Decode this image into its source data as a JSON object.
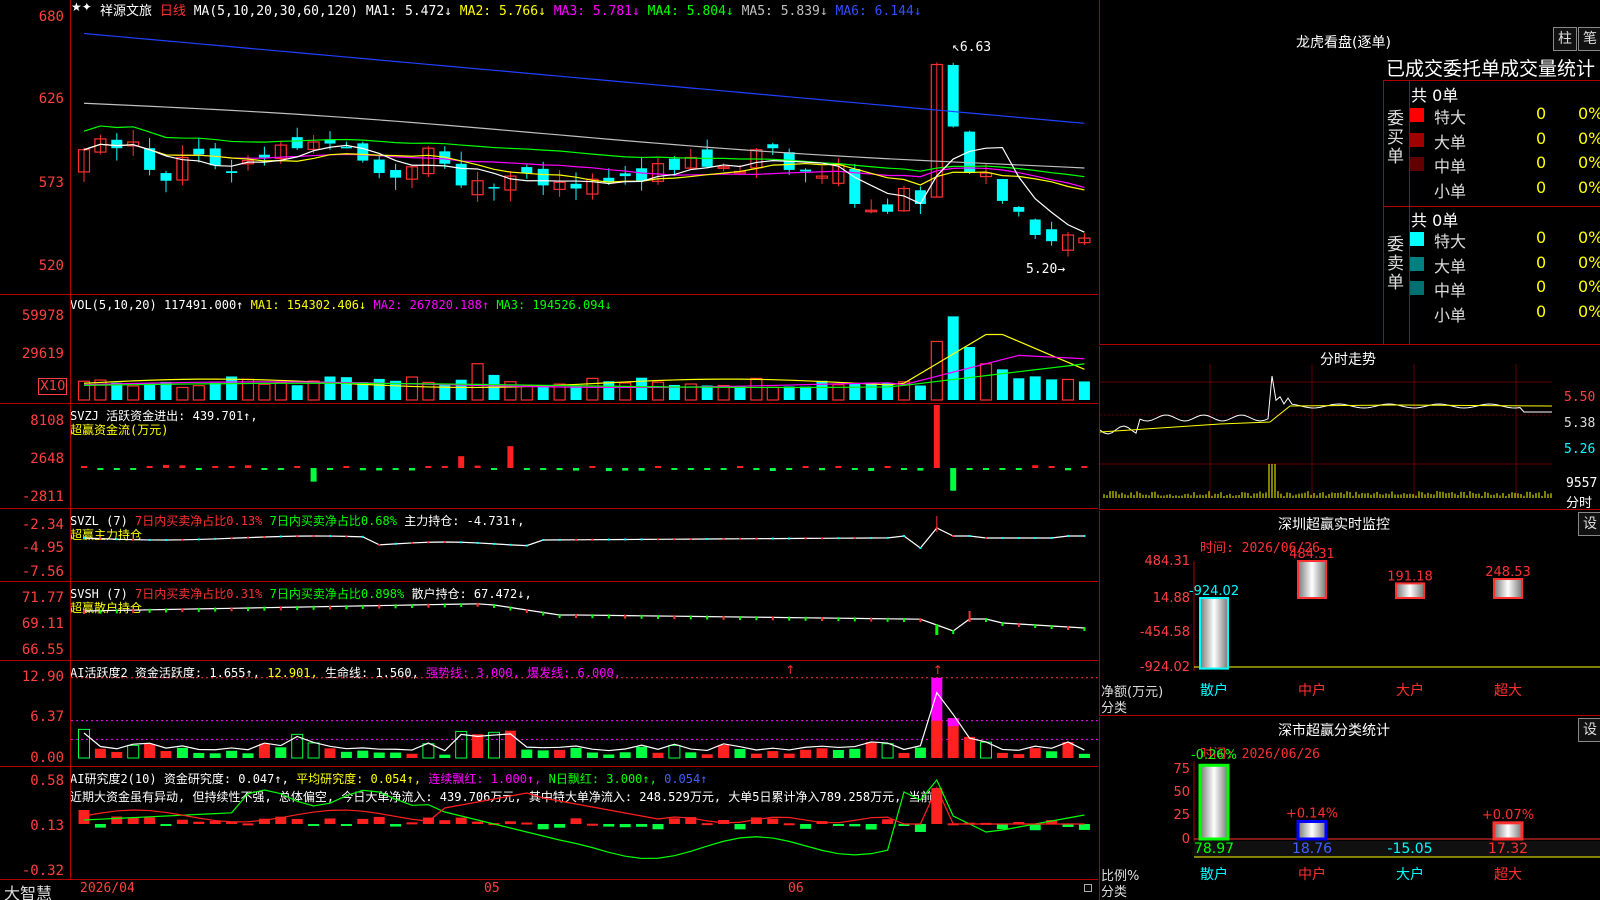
{
  "stock": {
    "name": "祥源文旅",
    "period": "日线"
  },
  "main": {
    "ma_label": "MA(5,10,20,30,60,120)",
    "ma": [
      {
        "n": "MA1:",
        "v": "5.472↓",
        "c": "#ffffff"
      },
      {
        "n": "MA2:",
        "v": "5.766↓",
        "c": "#ffff00"
      },
      {
        "n": "MA3:",
        "v": "5.781↓",
        "c": "#ff00ff"
      },
      {
        "n": "MA4:",
        "v": "5.804↓",
        "c": "#00ff00"
      },
      {
        "n": "MA5:",
        "v": "5.839↓",
        "c": "#c0c0c0"
      },
      {
        "n": "MA6:",
        "v": "6.144↓",
        "c": "#3050ff"
      }
    ],
    "y": [
      "680",
      "626",
      "573",
      "520"
    ],
    "hi": "6.63",
    "lo": "5.20"
  },
  "vol": {
    "label": "VOL(5,10,20)",
    "val": "117491.000↑",
    "ma1": "MA1: 154302.406↓",
    "ma2": "MA2: 267820.188↑",
    "ma3": "MA3: 194526.094↓",
    "y": [
      "59978",
      "29619",
      "X10"
    ]
  },
  "svzj": {
    "label": "SVZJ",
    "t1": "活跃资金进出: 439.701↑,",
    "t2": "超赢资金流(万元)",
    "y": [
      "8108",
      "2648",
      "-2811"
    ]
  },
  "svzl": {
    "label": "SVZL (7)",
    "a": "7日内买卖净占比0.13%",
    "b": "7日内买卖净占比0.68%",
    "c": "主力持仓: -4.731↑,",
    "t2": "超赢主力持仓",
    "y": [
      "-2.34",
      "-4.95",
      "-7.56"
    ]
  },
  "svsh": {
    "label": "SVSH (7)",
    "a": "7日内买卖净占比0.31%",
    "b": "7日内买卖净占比0.898%",
    "c": "散户持仓: 67.472↓,",
    "t2": "超赢散户持仓",
    "y": [
      "71.77",
      "69.11",
      "66.55"
    ]
  },
  "ai1": {
    "label": "AI活跃度2",
    "a": "资金活跃度: 1.655↑,",
    "b": "12.901,",
    "c": "生命线: 1.560,",
    "d": "强势线: 3.000,",
    "e": "爆发线: 6.000,",
    "y": [
      "12.90",
      "6.37",
      "0.00"
    ]
  },
  "ai2": {
    "label": "AI研究度2(10)",
    "a": "资金研究度: 0.047↑,",
    "b": "平均研究度: 0.054↑,",
    "c": "连续飘红: 1.000↑,",
    "d": "N日飘红: 3.000↑,",
    "e": "0.054↑",
    "note": "近期大资金虽有异动, 但持续性不强, 总体偏空, 今日大单净流入: 439.706万元, 其中特大单净流入: 248.529万元, 大单5日累计净入789.258万元, 当前",
    "y": [
      "0.58",
      "0.13",
      "-0.32"
    ]
  },
  "xaxis": {
    "d1": "2026/04",
    "d2": "05",
    "d3": "06"
  },
  "brand": "大智慧",
  "lhb": {
    "title": "龙虎看盘(逐单)",
    "btn1": "柱",
    "btn2": "笔",
    "subtitle": "已成交委托单成交量统计",
    "buy": {
      "side": "委买单",
      "total": "共 0单",
      "rows": [
        {
          "name": "特大",
          "n": "0",
          "p": "0%",
          "c": "#ff0000"
        },
        {
          "name": "大单",
          "n": "0",
          "p": "0%",
          "c": "#a00000"
        },
        {
          "name": "中单",
          "n": "0",
          "p": "0%",
          "c": "#600000"
        },
        {
          "name": "小单",
          "n": "0",
          "p": "0%",
          "c": "#000000"
        }
      ]
    },
    "sell": {
      "side": "委卖单",
      "total": "共 0单",
      "rows": [
        {
          "name": "特大",
          "n": "0",
          "p": "0%",
          "c": "#00ffff"
        },
        {
          "name": "大单",
          "n": "0",
          "p": "0%",
          "c": "#008080"
        },
        {
          "name": "中单",
          "n": "0",
          "p": "0%",
          "c": "#007070"
        },
        {
          "name": "小单",
          "n": "0",
          "p": "0%",
          "c": "#000000"
        }
      ]
    }
  },
  "fenshi": {
    "title": "分时走势",
    "y": [
      "5.50",
      "5.38",
      "5.26"
    ],
    "vol": "9557",
    "unit": "分时"
  },
  "monitor": {
    "title": "深圳超赢实时监控",
    "btn": "设",
    "time": "时间: 2026/06/26",
    "y": [
      "484.31",
      "14.88",
      "-454.58",
      "-924.02"
    ],
    "bars": [
      {
        "label": "-924.02",
        "value": -924.02
      },
      {
        "label": "484.31",
        "value": 484.31
      },
      {
        "label": "191.18",
        "value": 191.18
      },
      {
        "label": "248.53",
        "value": 248.53
      }
    ],
    "cats": [
      "散户",
      "中户",
      "大户",
      "超大"
    ],
    "ylabel": "净额(万元)",
    "xlabel": "分类"
  },
  "stats": {
    "title": "深市超赢分类统计",
    "btn": "设",
    "time": "时间: 2026/06/26",
    "y": [
      "75",
      "50",
      "25",
      "0"
    ],
    "top": [
      {
        "label": "-0.26%",
        "v": -0.26
      },
      {
        "label": "+0.14%",
        "v": 0.14
      },
      {
        "label": "",
        "v": 0
      },
      {
        "label": "+0.07%",
        "v": 0.07
      }
    ],
    "bottom": [
      "78.97",
      "18.76",
      "-15.05",
      "17.32"
    ],
    "bar_values": [
      78.97,
      18.76,
      0,
      17.32
    ],
    "cats": [
      "散户",
      "中户",
      "大户",
      "超大"
    ],
    "ylabel": "比例%",
    "xlabel": "分类"
  }
}
